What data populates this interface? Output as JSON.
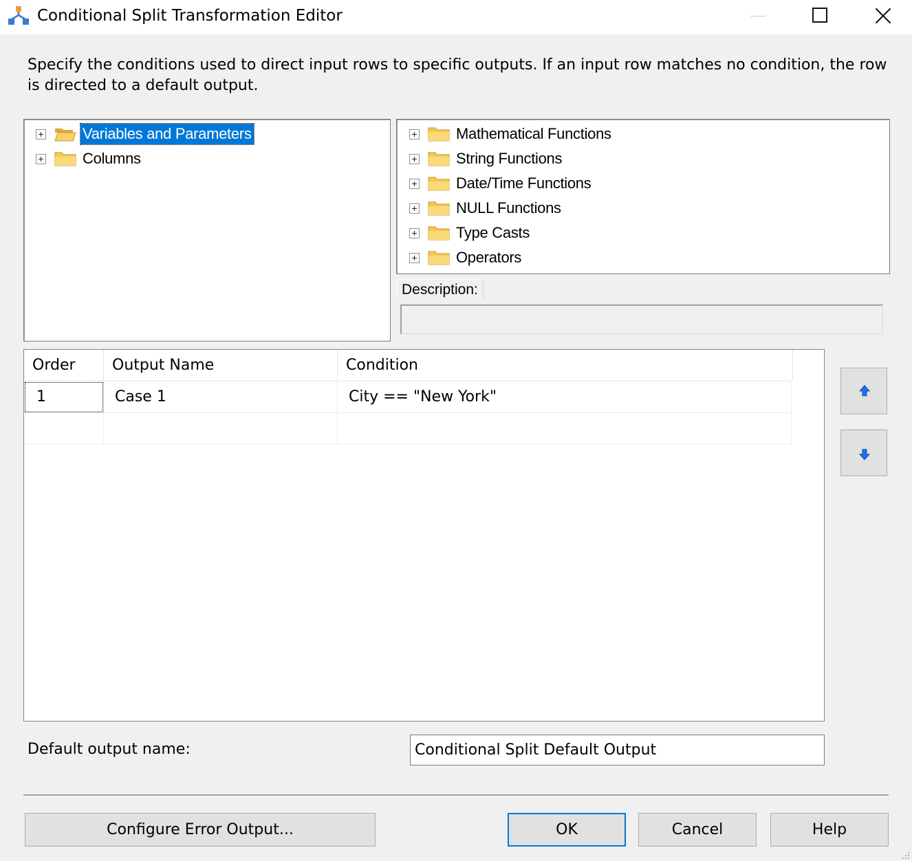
{
  "window": {
    "title": "Conditional Split Transformation Editor",
    "icon": "ssis-conditional-split-icon",
    "controls": [
      "minimize-icon",
      "maximize-icon",
      "close-icon"
    ]
  },
  "instructions": "Specify the conditions used to direct input rows to specific outputs. If an input row matches no condition, the row is directed to a default output.",
  "left_tree": {
    "items": [
      {
        "label": "Variables and Parameters",
        "selected": true,
        "icon": "folder-open-icon"
      },
      {
        "label": "Columns",
        "selected": false,
        "icon": "folder-icon"
      }
    ]
  },
  "right_tree": {
    "items": [
      {
        "label": "Mathematical Functions",
        "icon": "folder-icon"
      },
      {
        "label": "String Functions",
        "icon": "folder-icon"
      },
      {
        "label": "Date/Time Functions",
        "icon": "folder-icon"
      },
      {
        "label": "NULL Functions",
        "icon": "folder-icon"
      },
      {
        "label": "Type Casts",
        "icon": "folder-icon"
      },
      {
        "label": "Operators",
        "icon": "folder-icon"
      }
    ]
  },
  "description": {
    "label": "Description:",
    "value": ""
  },
  "grid": {
    "columns": [
      "Order",
      "Output Name",
      "Condition"
    ],
    "rows": [
      {
        "order": "1",
        "output_name": "Case 1",
        "condition": "City == \"New York\""
      },
      {
        "order": "",
        "output_name": "",
        "condition": ""
      }
    ]
  },
  "side_buttons": {
    "up_icon": "arrow-up-icon",
    "down_icon": "arrow-down-icon"
  },
  "default_output": {
    "label": "Default output name:",
    "value": "Conditional Split Default Output"
  },
  "buttons": {
    "configure_error": "Configure Error Output...",
    "ok": "OK",
    "cancel": "Cancel",
    "help": "Help"
  },
  "colors": {
    "selection": "#0078d7",
    "folder": "#f5c84c",
    "arrow": "#1a73e8"
  }
}
